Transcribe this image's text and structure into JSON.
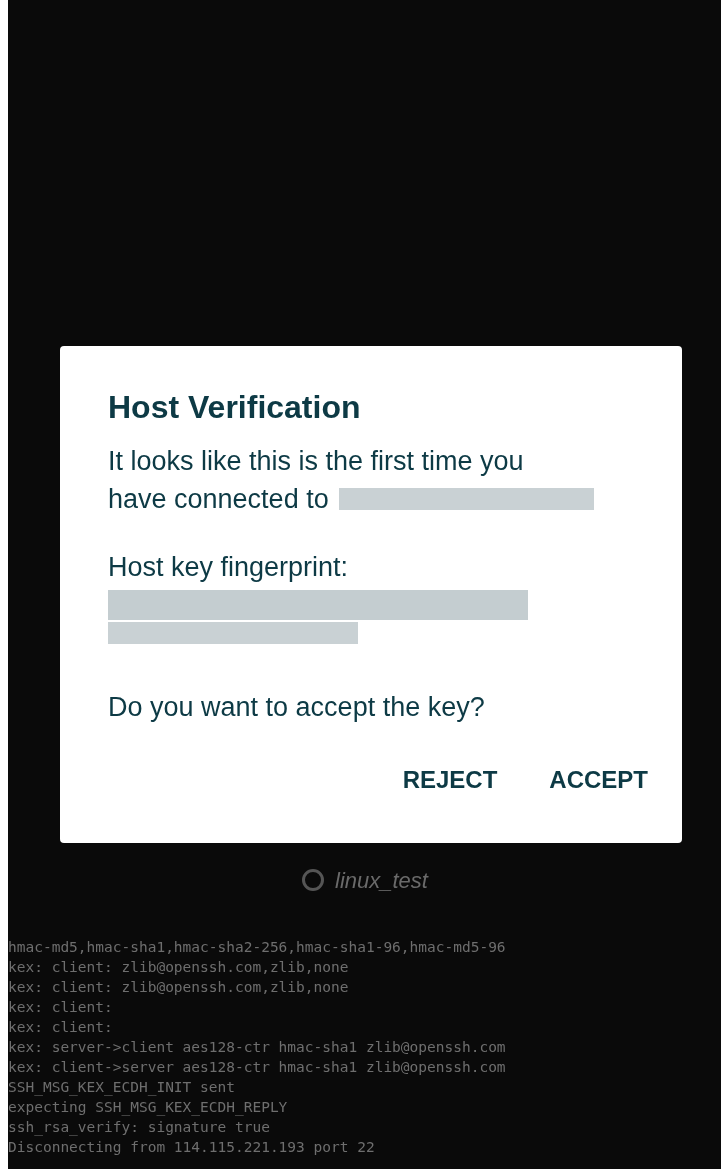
{
  "dialog": {
    "title": "Host Verification",
    "message_lines": [
      "It looks like this is the first time you",
      "have connected to"
    ],
    "fingerprint_label": "Host key fingerprint:",
    "question": "Do you want to accept the key?",
    "buttons": [
      "REJECT",
      "ACCEPT"
    ]
  },
  "connection": {
    "host_label": "linux_test"
  },
  "log": [
    "hmac-md5,hmac-sha1,hmac-sha2-256,hmac-sha1-96,hmac-md5-96",
    "kex: client: zlib@openssh.com,zlib,none",
    "kex: client: zlib@openssh.com,zlib,none",
    "kex: client:",
    "kex: client:",
    "kex: server->client aes128-ctr hmac-sha1 zlib@openssh.com",
    "kex: client->server aes128-ctr hmac-sha1 zlib@openssh.com",
    "SSH_MSG_KEX_ECDH_INIT sent",
    "expecting SSH_MSG_KEX_ECDH_REPLY",
    "ssh_rsa_verify: signature true",
    "Disconnecting from 114.115.221.193 port 22"
  ]
}
